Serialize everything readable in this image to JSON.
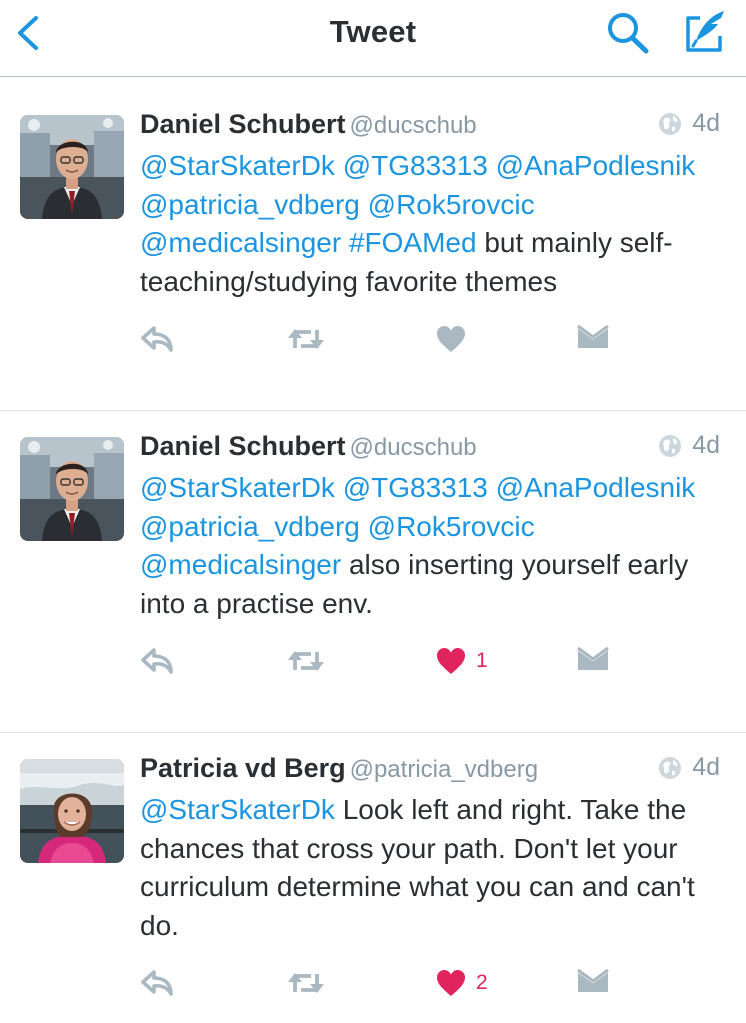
{
  "nav": {
    "title": "Tweet"
  },
  "tweets": [
    {
      "name": "Daniel Schubert",
      "handle": "@ducschub",
      "time": "4d",
      "segments": [
        {
          "text": "@StarSkaterDk",
          "link": true
        },
        {
          "text": " ",
          "link": false
        },
        {
          "text": "@TG83313",
          "link": true
        },
        {
          "text": " ",
          "link": false
        },
        {
          "text": "@AnaPodlesnik",
          "link": true
        },
        {
          "text": " ",
          "link": false
        },
        {
          "text": "@patricia_vdberg",
          "link": true
        },
        {
          "text": " ",
          "link": false
        },
        {
          "text": "@Rok5rovcic",
          "link": true
        },
        {
          "text": " ",
          "link": false
        },
        {
          "text": "@medicalsinger",
          "link": true
        },
        {
          "text": " ",
          "link": false
        },
        {
          "text": "#FOAMed",
          "link": true
        },
        {
          "text": " but mainly self-teaching/studying favorite themes",
          "link": false
        }
      ],
      "liked": false,
      "like_count": ""
    },
    {
      "name": "Daniel Schubert",
      "handle": "@ducschub",
      "time": "4d",
      "segments": [
        {
          "text": "@StarSkaterDk",
          "link": true
        },
        {
          "text": " ",
          "link": false
        },
        {
          "text": "@TG83313",
          "link": true
        },
        {
          "text": " ",
          "link": false
        },
        {
          "text": "@AnaPodlesnik",
          "link": true
        },
        {
          "text": " ",
          "link": false
        },
        {
          "text": "@patricia_vdberg",
          "link": true
        },
        {
          "text": " ",
          "link": false
        },
        {
          "text": "@Rok5rovcic",
          "link": true
        },
        {
          "text": " ",
          "link": false
        },
        {
          "text": "@medicalsinger",
          "link": true
        },
        {
          "text": " also inserting yourself early into a practise env.",
          "link": false
        }
      ],
      "liked": true,
      "like_count": "1"
    },
    {
      "name": "Patricia vd Berg",
      "handle": "@patricia_vdberg",
      "time": "4d",
      "segments": [
        {
          "text": "@StarSkaterDk",
          "link": true
        },
        {
          "text": " Look left and right. Take the chances that cross your path. Don't let your curriculum determine what you can and can't do.",
          "link": false
        }
      ],
      "liked": true,
      "like_count": "2"
    }
  ],
  "colors": {
    "accent": "#1b95e0",
    "icon_gray": "#aab8c2",
    "like_red": "#e0245e",
    "text": "#292f33",
    "secondary": "#8899a6"
  },
  "icons": {
    "back": "chevron-left-icon",
    "search": "search-icon",
    "compose": "compose-icon",
    "globe": "globe-icon",
    "reply": "reply-icon",
    "retweet": "retweet-icon",
    "like": "heart-icon",
    "dm": "direct-message-icon"
  }
}
